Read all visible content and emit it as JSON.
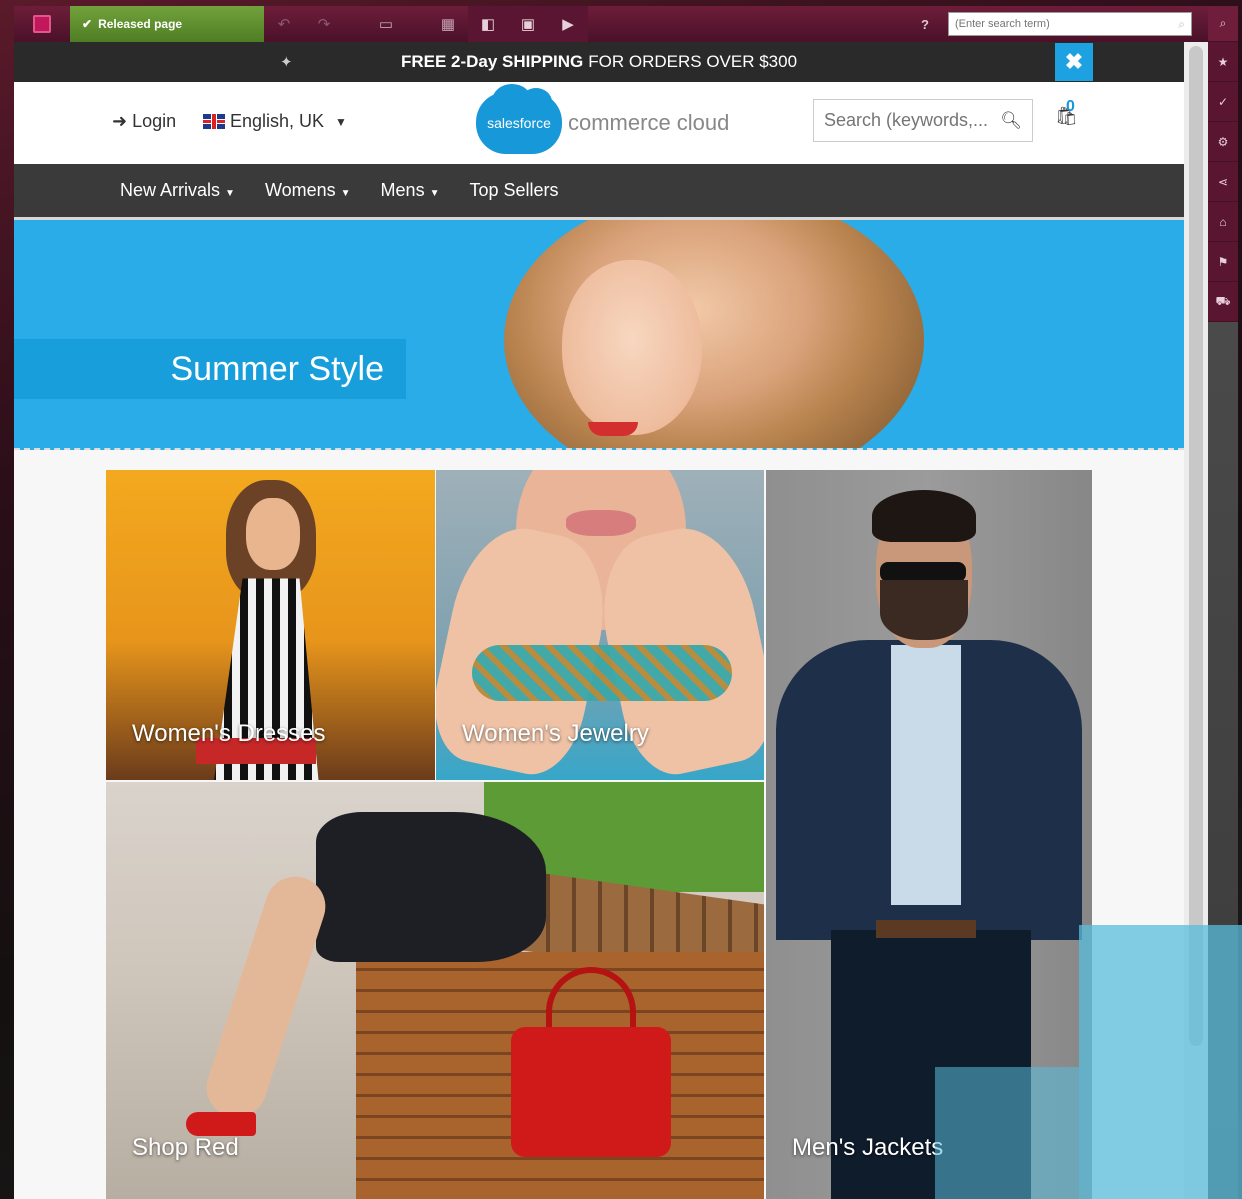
{
  "editor_toolbar": {
    "status_label": "Released page",
    "help_label": "?",
    "search_placeholder": "(Enter search term)"
  },
  "promo": {
    "strong_text": "FREE 2-Day SHIPPING",
    "text": "FOR ORDERS OVER $300"
  },
  "header": {
    "login_label": "Login",
    "language_label": "English, UK",
    "brand_cloud_text": "salesforce",
    "brand_text": "commerce cloud",
    "search_placeholder": "Search (keywords,...",
    "cart_count": "0"
  },
  "nav": {
    "items": [
      {
        "label": "New Arrivals",
        "dropdown": true
      },
      {
        "label": "Womens",
        "dropdown": true
      },
      {
        "label": "Mens",
        "dropdown": true
      },
      {
        "label": "Top Sellers",
        "dropdown": false
      }
    ]
  },
  "hero": {
    "label": "Summer Style"
  },
  "categories": [
    {
      "label": "Women's Dresses"
    },
    {
      "label": "Women's Jewelry"
    },
    {
      "label": "Shop Red"
    },
    {
      "label": "Men's Jackets"
    }
  ],
  "colors": {
    "editor_bar": "#6e1d3a",
    "status_green": "#72a23c",
    "brand_blue": "#1798d8",
    "nav_bg": "#3a3a3a",
    "hero_blue": "#2aace8"
  }
}
